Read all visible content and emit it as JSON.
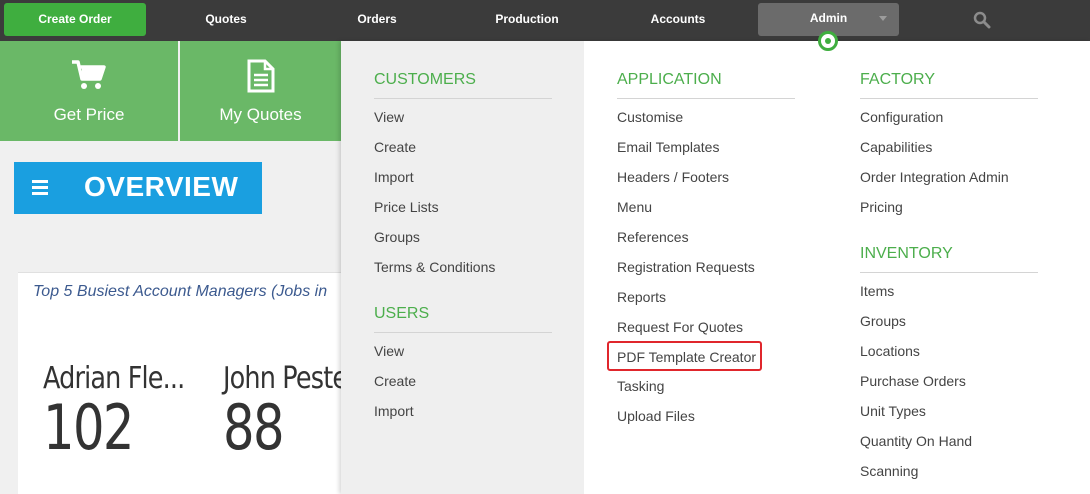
{
  "topnav": {
    "create_order": "Create Order",
    "quotes": "Quotes",
    "orders": "Orders",
    "production": "Production",
    "accounts": "Accounts",
    "admin": "Admin"
  },
  "tiles": {
    "get_price": "Get Price",
    "my_quotes": "My Quotes"
  },
  "overview": {
    "title": "OVERVIEW"
  },
  "panel": {
    "title": "Top 5 Busiest Account Managers (Jobs in",
    "managers": [
      {
        "name": "Adrian Fle...",
        "count": "102"
      },
      {
        "name": "John Pestell",
        "count": "88"
      }
    ]
  },
  "menu": {
    "customers": {
      "heading": "CUSTOMERS",
      "items": [
        "View",
        "Create",
        "Import",
        "Price Lists",
        "Groups",
        "Terms & Conditions"
      ]
    },
    "users": {
      "heading": "USERS",
      "items": [
        "View",
        "Create",
        "Import"
      ]
    },
    "application": {
      "heading": "APPLICATION",
      "items": [
        "Customise",
        "Email Templates",
        "Headers / Footers",
        "Menu",
        "References",
        "Registration Requests",
        "Reports",
        "Request For Quotes",
        "PDF Template Creator",
        "Tasking",
        "Upload Files"
      ]
    },
    "factory": {
      "heading": "FACTORY",
      "items": [
        "Configuration",
        "Capabilities",
        "Order Integration Admin",
        "Pricing"
      ]
    },
    "inventory": {
      "heading": "INVENTORY",
      "items": [
        "Items",
        "Groups",
        "Locations",
        "Purchase Orders",
        "Unit Types",
        "Quantity On Hand",
        "Scanning"
      ]
    }
  },
  "colors": {
    "nav_bg": "#3b3b3b",
    "accent_green": "#4cae4c",
    "overview_blue": "#1a9fe0",
    "highlight_red": "#e0262c"
  }
}
